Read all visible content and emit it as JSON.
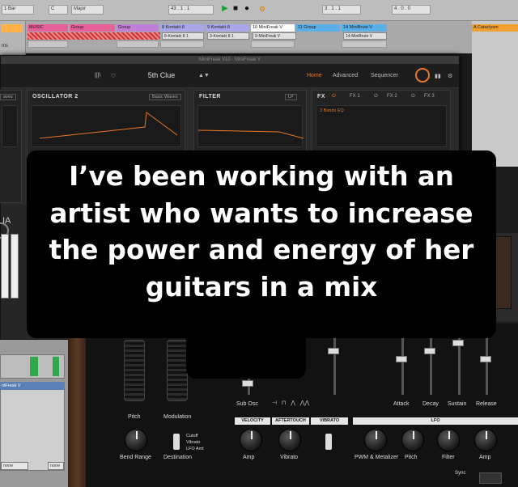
{
  "transport": {
    "bar_length": "1 Bar",
    "key": "C",
    "scale": "Major",
    "position": "43 . 1 . 1",
    "loop_start": "3 . 1 . 1",
    "loop_length": "4 . 0 . 0"
  },
  "tracks": [
    {
      "name": "MUSIC",
      "color": "#e8609a"
    },
    {
      "name": "Group",
      "color": "#e8609a"
    },
    {
      "name": "Group",
      "color": "#c27fd8"
    },
    {
      "name": "8 Kontakt 8",
      "color": "#a8a8e8"
    },
    {
      "name": "9 Kontakt 8",
      "color": "#a8a8e8"
    },
    {
      "name": "10 MiniFreak V",
      "color": "#ffffff"
    },
    {
      "name": "11 Group",
      "color": "#5bb0e8"
    },
    {
      "name": "14 MiniBrute V",
      "color": "#5bb0e8"
    }
  ],
  "clips": [
    "8-Kontakt 8 1",
    "3-Kontakt 8 1",
    "9-MiniFreak V",
    "14-MiniBrute V"
  ],
  "right_track": {
    "name": "A Cataclysm",
    "color": "#f0a030"
  },
  "left_panel": {
    "label": "ms"
  },
  "minifreak": {
    "window_title": "MiniFreak V10 - MiniFreak V",
    "preset_name": "5th Clue",
    "nav": {
      "home": "Home",
      "advanced": "Advanced",
      "sequencer": "Sequencer"
    },
    "osc1_tag": "aves",
    "osc2_title": "OSCILLATOR 2",
    "osc2_tag": "Basic Waves",
    "filter_title": "FILTER",
    "filter_tag": "LP",
    "fx_title": "FX",
    "fx_tabs": [
      "FX 1",
      "FX 2",
      "FX 3"
    ],
    "fx_preset": "3 Bands EQ",
    "side_label": "me",
    "brand_fragment": "IA"
  },
  "hardware": {
    "wheel_labels": [
      "Pitch",
      "Modulation"
    ],
    "osc_labels": [
      "Sub Osc"
    ],
    "env_labels": [
      "Attack",
      "Decay",
      "Sustain",
      "Release"
    ],
    "section_bars": [
      "VELOCITY",
      "AFTERTOUCH",
      "VIBRATO",
      "LFO"
    ],
    "mod_dest": [
      "Cutoff",
      "Vibrato",
      "LFO Amt"
    ],
    "knob_labels": [
      "Bend Range",
      "Destination",
      "Amp",
      "Vibrato",
      "PWM & Metalizer",
      "Pitch",
      "Filter",
      "Amp"
    ],
    "sync_label": "Sync"
  },
  "left_bottom": {
    "device_title": "niFreak V",
    "field_left": "none",
    "field_right": "none"
  },
  "caption": "I’ve been working with an artist who wants to increase the power and energy of her guitars in a mix"
}
